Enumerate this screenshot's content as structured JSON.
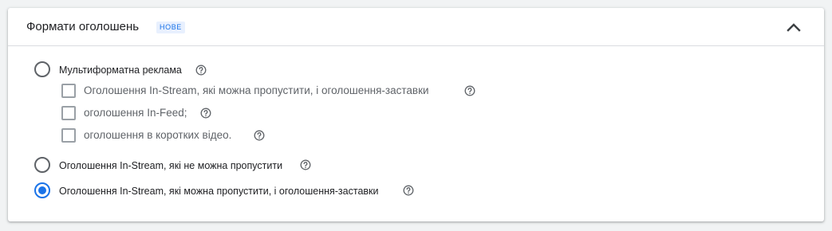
{
  "section": {
    "title": "Формати оголошень",
    "badge": "НОВЕ"
  },
  "options": [
    {
      "label": "Мультиформатна реклама",
      "selected": false,
      "suboptions": [
        {
          "label": "Оголошення In-Stream, які можна пропустити, і оголошення-заставки",
          "checked": false
        },
        {
          "label": "оголошення In-Feed;",
          "checked": false
        },
        {
          "label": "оголошення в коротких відео.",
          "checked": false
        }
      ]
    },
    {
      "label": "Оголошення In-Stream, які не можна пропустити",
      "selected": false
    },
    {
      "label": "Оголошення In-Stream, які можна пропустити, і оголошення-заставки",
      "selected": true
    }
  ],
  "icons": {
    "help": "help-circle-icon",
    "collapse": "chevron-up-icon"
  },
  "colors": {
    "accent": "#1a73e8",
    "badge_bg": "#e8f0fe"
  }
}
